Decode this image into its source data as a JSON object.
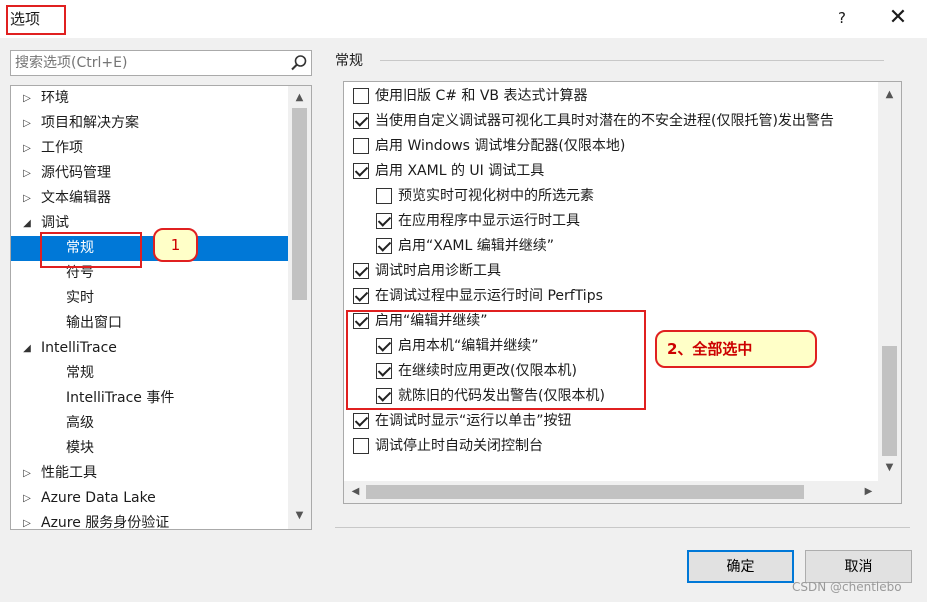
{
  "window": {
    "title": "选项",
    "help": "?",
    "close": "✕"
  },
  "search": {
    "placeholder": "搜索选项(Ctrl+E)"
  },
  "tree": {
    "items": [
      {
        "label": "环境",
        "arrow": "▷"
      },
      {
        "label": "项目和解决方案",
        "arrow": "▷"
      },
      {
        "label": "工作项",
        "arrow": "▷"
      },
      {
        "label": "源代码管理",
        "arrow": "▷"
      },
      {
        "label": "文本编辑器",
        "arrow": "▷"
      },
      {
        "label": "调试",
        "arrow": "◢"
      },
      {
        "label": "常规",
        "arrow": "",
        "selected": true
      },
      {
        "label": "符号",
        "arrow": ""
      },
      {
        "label": "实时",
        "arrow": ""
      },
      {
        "label": "输出窗口",
        "arrow": ""
      },
      {
        "label": "IntelliTrace",
        "arrow": "◢"
      },
      {
        "label": "常规",
        "arrow": ""
      },
      {
        "label": "IntelliTrace 事件",
        "arrow": ""
      },
      {
        "label": "高级",
        "arrow": ""
      },
      {
        "label": "模块",
        "arrow": ""
      },
      {
        "label": "性能工具",
        "arrow": "▷"
      },
      {
        "label": "Azure Data Lake",
        "arrow": "▷"
      },
      {
        "label": "Azure 服务身份验证",
        "arrow": "▷"
      }
    ],
    "scroll_up": "▲",
    "scroll_down": "▼"
  },
  "section": {
    "title": "常规"
  },
  "options": [
    {
      "label": "使用旧版 C# 和 VB 表达式计算器",
      "checked": false
    },
    {
      "label": "当使用自定义调试器可视化工具时对潜在的不安全进程(仅限托管)发出警告",
      "checked": true
    },
    {
      "label": "启用 Windows 调试堆分配器(仅限本地)",
      "checked": false
    },
    {
      "label": "启用 XAML 的 UI 调试工具",
      "checked": true
    },
    {
      "label": "预览实时可视化树中的所选元素",
      "checked": false
    },
    {
      "label": "在应用程序中显示运行时工具",
      "checked": true
    },
    {
      "label": "启用“XAML 编辑并继续”",
      "checked": true
    },
    {
      "label": "调试时启用诊断工具",
      "checked": true
    },
    {
      "label": "在调试过程中显示运行时间 PerfTips",
      "checked": true
    },
    {
      "label": "启用“编辑并继续”",
      "checked": true
    },
    {
      "label": "启用本机“编辑并继续”",
      "checked": true
    },
    {
      "label": "在继续时应用更改(仅限本机)",
      "checked": true
    },
    {
      "label": "就陈旧的代码发出警告(仅限本机)",
      "checked": true
    },
    {
      "label": "在调试时显示“运行以单击”按钮",
      "checked": true
    },
    {
      "label": "调试停止时自动关闭控制台",
      "checked": false
    }
  ],
  "panel_scroll": {
    "up": "▲",
    "down": "▼",
    "left": "◀",
    "right": "▶"
  },
  "annotations": {
    "step1": "1",
    "step2": "2、全部选中"
  },
  "buttons": {
    "ok": "确定",
    "cancel": "取消"
  },
  "watermark": "CSDN @chentlebo",
  "colors": {
    "selection": "#0078d7",
    "annotation": "#e02020",
    "bubble_fill": "#ffffc8"
  }
}
